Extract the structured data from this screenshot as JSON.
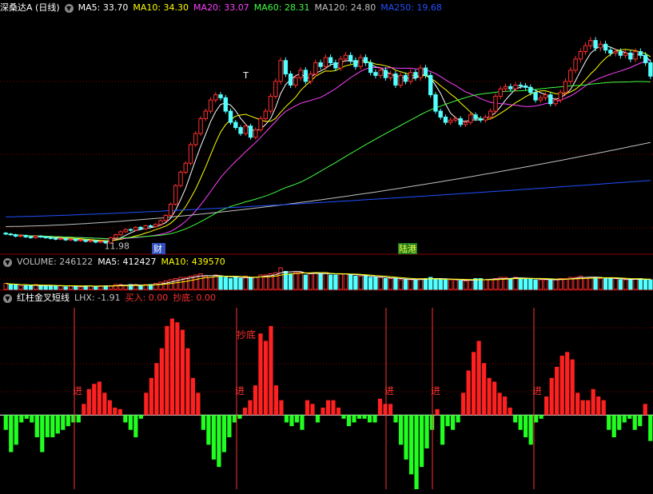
{
  "price_panel": {
    "title": "深桑达A (日线)",
    "ma_labels": [
      {
        "name": "MA5",
        "text": "MA5: 33.70",
        "color": "#ffffff"
      },
      {
        "name": "MA10",
        "text": "MA10: 34.30",
        "color": "#ffff00"
      },
      {
        "name": "MA20",
        "text": "MA20: 33.07",
        "color": "#ff40ff"
      },
      {
        "name": "MA60",
        "text": "MA60: 28.31",
        "color": "#40ff40"
      },
      {
        "name": "MA120",
        "text": "MA120: 24.80",
        "color": "#c0c0c0"
      },
      {
        "name": "MA250",
        "text": "MA250: 19.68",
        "color": "#2050ff"
      }
    ],
    "annotations": {
      "low_price": "11.98",
      "marker_t": "T",
      "event_cai": "财",
      "event_lugang": "陆港"
    }
  },
  "volume_panel": {
    "labels": [
      {
        "text": "VOLUME: 246122",
        "color": "#c0c0c0"
      },
      {
        "text": "MA5: 412427",
        "color": "#ffffff"
      },
      {
        "text": "MA10: 439570",
        "color": "#ffff00"
      }
    ]
  },
  "indicator_panel": {
    "name": "红柱金叉短线",
    "labels": [
      {
        "text": "LHX: -1.91",
        "color": "#c0c0c0"
      },
      {
        "text": "买入: 0.00",
        "color": "#ff3030"
      },
      {
        "text": "抄底: 0.00",
        "color": "#ff3030"
      }
    ],
    "signal_jin": "进",
    "signal_chaodi": "抄底"
  },
  "colors": {
    "up": "#ff3030",
    "down": "#54ffff",
    "grid": "#8b0000",
    "macd_pos": "#ff2020",
    "macd_neg": "#20ff20"
  },
  "chart_data": [
    {
      "type": "candlestick",
      "title": "深桑达A (日线)",
      "ylim": [
        10,
        42
      ],
      "low_annotation": 11.98,
      "close": [
        12.5,
        12.4,
        12.2,
        12.3,
        12.1,
        12.0,
        12.2,
        12.1,
        12.0,
        11.9,
        11.8,
        11.9,
        11.7,
        11.8,
        11.6,
        11.7,
        11.5,
        11.6,
        11.4,
        11.5,
        11.3,
        11.98,
        12.4,
        12.8,
        13.1,
        13.0,
        13.4,
        13.2,
        13.6,
        13.5,
        13.8,
        14.3,
        15.0,
        16.5,
        19.0,
        20.8,
        22.0,
        24.5,
        26.0,
        28.0,
        29.0,
        30.5,
        31.2,
        30.8,
        29.0,
        27.5,
        26.8,
        26.0,
        27.0,
        25.5,
        26.5,
        28.0,
        29.0,
        31.0,
        33.0,
        35.8,
        34.0,
        32.5,
        33.5,
        34.5,
        33.0,
        34.0,
        35.5,
        35.0,
        36.2,
        35.5,
        34.8,
        36.0,
        36.5,
        35.8,
        35.0,
        36.2,
        35.5,
        34.2,
        33.8,
        34.5,
        33.5,
        34.0,
        32.5,
        33.8,
        33.0,
        34.2,
        33.5,
        34.8,
        33.8,
        31.2,
        29.0,
        28.2,
        27.5,
        27.8,
        28.0,
        27.2,
        27.5,
        28.5,
        28.0,
        27.8,
        28.2,
        29.0,
        31.0,
        32.0,
        32.3,
        32.0,
        32.5,
        32.4,
        32.2,
        31.5,
        30.5,
        30.8,
        31.2,
        30.0,
        30.5,
        31.5,
        33.0,
        34.5,
        36.0,
        37.0,
        37.8,
        38.5,
        37.5,
        38.0,
        37.2,
        36.8,
        37.0,
        36.5,
        36.8,
        36.0,
        37.0,
        36.5,
        35.5,
        33.7
      ]
    },
    {
      "type": "bar",
      "title": "VOLUME",
      "values": [
        5,
        4,
        4,
        3,
        3,
        3,
        4,
        3,
        3,
        3,
        3,
        3,
        2,
        3,
        3,
        2,
        3,
        3,
        2,
        3,
        3,
        3,
        4,
        4,
        3,
        4,
        4,
        3,
        4,
        4,
        5,
        6,
        7,
        8,
        9,
        10,
        10,
        11,
        12,
        13,
        11,
        10,
        12,
        11,
        10,
        9,
        10,
        9,
        11,
        10,
        10,
        12,
        12,
        13,
        14,
        18,
        15,
        13,
        14,
        14,
        12,
        13,
        14,
        13,
        14,
        12,
        12,
        13,
        13,
        12,
        11,
        11,
        11,
        10,
        10,
        10,
        9,
        9,
        9,
        8,
        8,
        8,
        8,
        9,
        9,
        10,
        9,
        8,
        8,
        8,
        8,
        7,
        7,
        8,
        9,
        9,
        8,
        8,
        9,
        10,
        10,
        9,
        10,
        9,
        9,
        9,
        8,
        8,
        8,
        8,
        8,
        9,
        9,
        10,
        10,
        11,
        10,
        10,
        10,
        9,
        9,
        9,
        9,
        8,
        8,
        8,
        9,
        9,
        8,
        8
      ]
    },
    {
      "type": "bar",
      "title": "红柱金叉短线",
      "ylim": [
        -10,
        15
      ],
      "values": [
        -2,
        -5,
        -4,
        -1,
        -0.5,
        -1,
        -3,
        -5,
        -3,
        -3,
        -2.5,
        -2,
        -1.5,
        -1,
        -1,
        1.5,
        3.5,
        4.2,
        4.5,
        3,
        2,
        1,
        0.8,
        -1,
        -2,
        -3,
        -0.5,
        3,
        5,
        7,
        9,
        12,
        13,
        12.5,
        11.5,
        9,
        5,
        3,
        -2,
        -4,
        -6,
        -7,
        -5,
        -3,
        -1,
        -0.5,
        1,
        2,
        4,
        11,
        10,
        12,
        4,
        2,
        -1,
        -1.5,
        -1,
        -2,
        2,
        1.5,
        -1,
        1,
        2,
        2,
        1,
        -0.5,
        -1.5,
        -1,
        -0.5,
        -0.5,
        -1,
        -1,
        2.2,
        1.5,
        1.5,
        -1,
        -4,
        -6,
        -8,
        -10,
        -7,
        -4.5,
        -2,
        0.8,
        -4,
        -1.5,
        -2,
        -1,
        3,
        6,
        8.5,
        10,
        7,
        5,
        4.5,
        3,
        2.5,
        1,
        -1,
        -2,
        -3,
        -4,
        -1,
        -0.5,
        2.5,
        5,
        6.5,
        8,
        8.5,
        7.5,
        3,
        2,
        2,
        3.5,
        2.5,
        2,
        -2,
        -3,
        -2,
        -1,
        -0.5,
        -2,
        -1.5,
        1.5,
        -3.5
      ]
    }
  ]
}
